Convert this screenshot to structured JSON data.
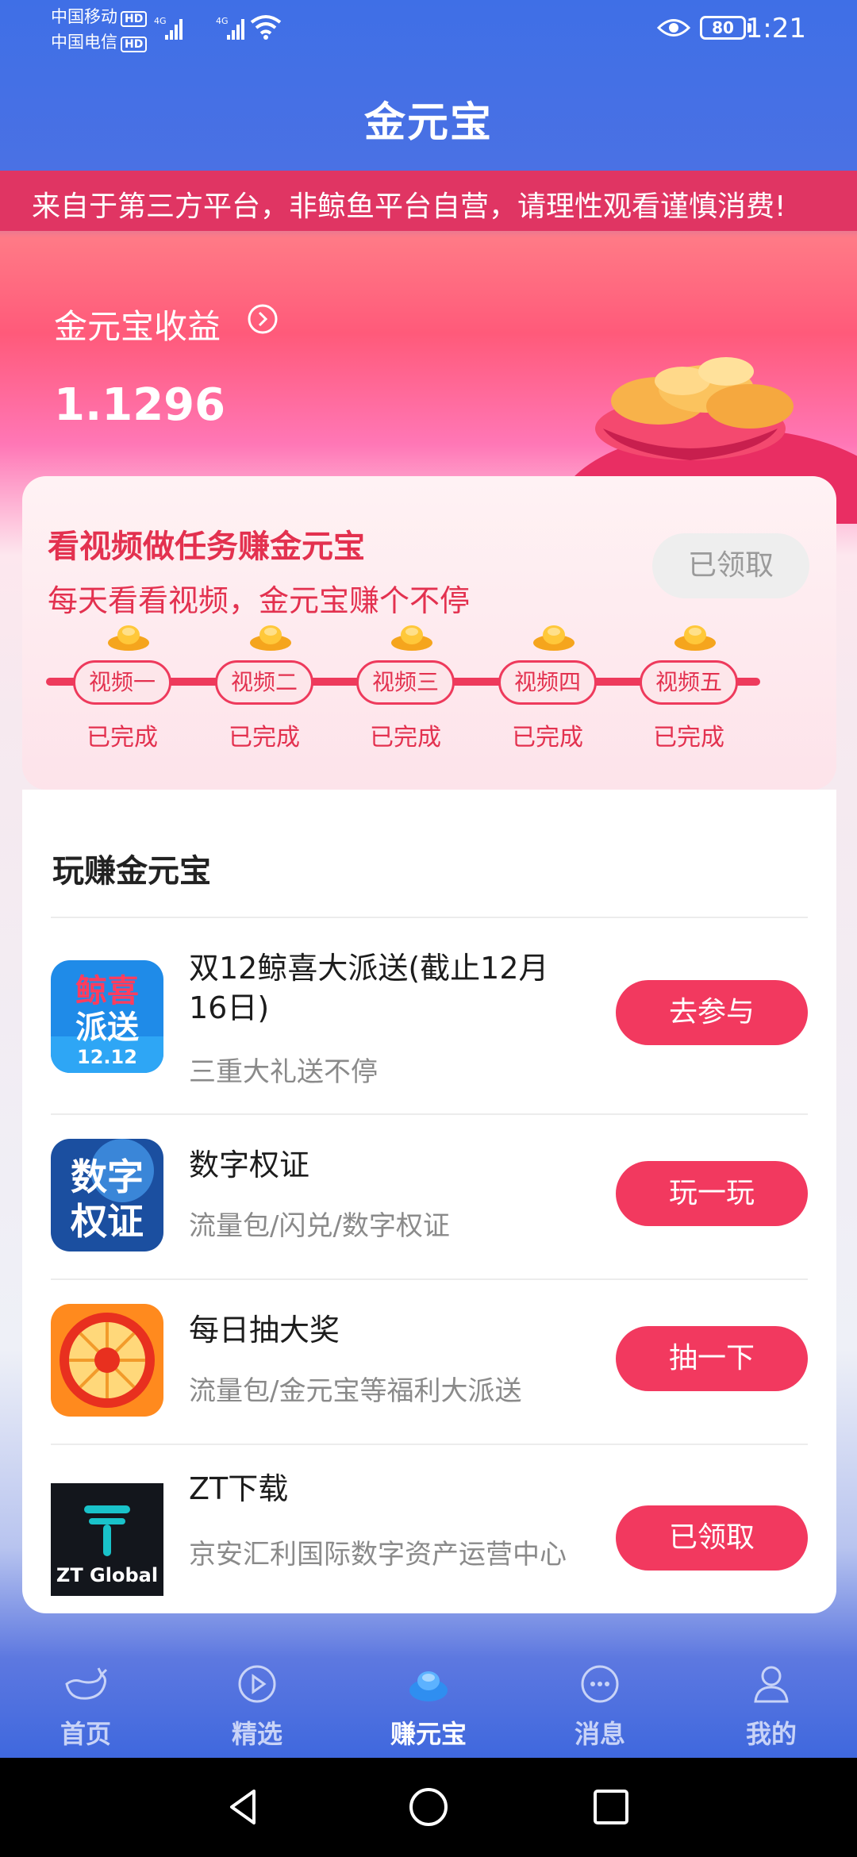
{
  "status_bar": {
    "carrier1": "中国移动",
    "carrier2": "中国电信",
    "hd": "HD",
    "net1": "4G",
    "net2": "4G",
    "battery": "80",
    "time": "1:21"
  },
  "header": {
    "title": "金元宝"
  },
  "notice": {
    "text": "来自于第三方平台，非鲸鱼平台自营，请理性观看谨慎消费!"
  },
  "earnings": {
    "label": "金元宝收益",
    "value": "1.1296"
  },
  "task": {
    "title": "看视频做任务赚金元宝",
    "subtitle": "每天看看视频，金元宝赚个不停",
    "claim_label": "已领取",
    "steps": [
      {
        "label": "视频一",
        "status": "已完成"
      },
      {
        "label": "视频二",
        "status": "已完成"
      },
      {
        "label": "视频三",
        "status": "已完成"
      },
      {
        "label": "视频四",
        "status": "已完成"
      },
      {
        "label": "视频五",
        "status": "已完成"
      }
    ]
  },
  "section": {
    "title": "玩赚金元宝"
  },
  "items": [
    {
      "title": "双12鲸喜大派送(截止12月16日)",
      "desc": "三重大礼送不停",
      "button": "去参与",
      "icon_text_top": "鲸喜",
      "icon_text_bottom": "派送",
      "icon_date": "12.12"
    },
    {
      "title": "数字权证",
      "desc": "流量包/闪兑/数字权证",
      "button": "玩一玩",
      "icon_text_top": "数字",
      "icon_text_bottom": "权证"
    },
    {
      "title": "每日抽大奖",
      "desc": "流量包/金元宝等福利大派送",
      "button": "抽一下"
    },
    {
      "title": "ZT下载",
      "desc": "京安汇利国际数字资产运营中心",
      "button": "已领取",
      "icon_text": "ZT Global"
    }
  ],
  "nav": [
    {
      "label": "首页",
      "icon": "whale-icon"
    },
    {
      "label": "精选",
      "icon": "play-circle-icon"
    },
    {
      "label": "赚元宝",
      "icon": "ingot-icon"
    },
    {
      "label": "消息",
      "icon": "message-icon"
    },
    {
      "label": "我的",
      "icon": "person-icon"
    }
  ],
  "colors": {
    "accent": "#f2395f",
    "header_blue": "#4a71e4",
    "notice_bg": "#e03563"
  }
}
